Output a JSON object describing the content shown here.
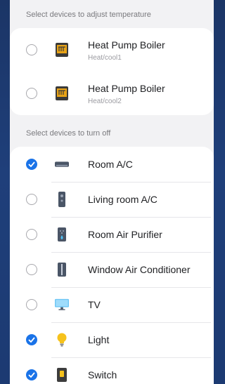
{
  "sections": {
    "adjust_header": "Select devices to adjust temperature",
    "turnoff_header": "Select devices to turn off"
  },
  "adjust_devices": [
    {
      "name": "Heat Pump Boiler",
      "subtitle": "Heat/cool1",
      "selected": false,
      "icon": "boiler-icon"
    },
    {
      "name": "Heat Pump Boiler",
      "subtitle": "Heat/cool2",
      "selected": false,
      "icon": "boiler-icon"
    }
  ],
  "turnoff_devices": [
    {
      "name": "Room A/C",
      "selected": true,
      "icon": "air-conditioner-icon"
    },
    {
      "name": "Living room A/C",
      "selected": false,
      "icon": "standing-ac-icon"
    },
    {
      "name": "Room Air Purifier",
      "selected": false,
      "icon": "air-purifier-icon"
    },
    {
      "name": "Window Air Conditioner",
      "selected": false,
      "icon": "window-ac-icon"
    },
    {
      "name": "TV",
      "selected": false,
      "icon": "tv-icon"
    },
    {
      "name": "Light",
      "selected": true,
      "icon": "light-bulb-icon"
    },
    {
      "name": "Switch",
      "selected": true,
      "icon": "switch-icon"
    }
  ],
  "colors": {
    "accent": "#1a73e8",
    "background": "#1f3f7a",
    "card": "#ffffff",
    "sheet": "#f2f2f4"
  }
}
